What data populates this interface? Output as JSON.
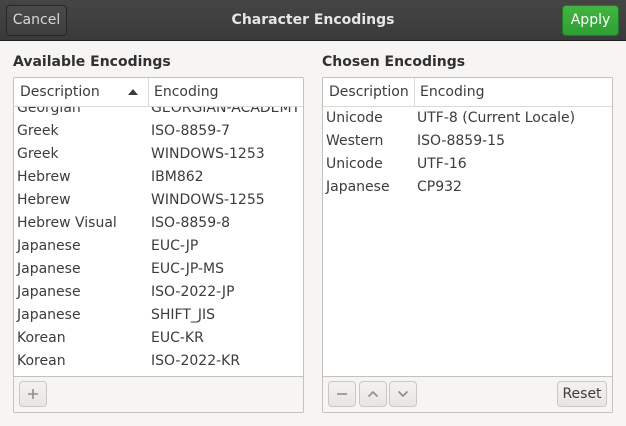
{
  "header": {
    "cancel_label": "Cancel",
    "title": "Character Encodings",
    "apply_label": "Apply",
    "apply_color": "#3daf3d"
  },
  "available": {
    "title": "Available Encodings",
    "columns": {
      "description": "Description",
      "encoding": "Encoding"
    },
    "rows": [
      {
        "description": "Georgian",
        "encoding": "GEORGIAN-ACADEMY"
      },
      {
        "description": "Greek",
        "encoding": "ISO-8859-7"
      },
      {
        "description": "Greek",
        "encoding": "WINDOWS-1253"
      },
      {
        "description": "Hebrew",
        "encoding": "IBM862"
      },
      {
        "description": "Hebrew",
        "encoding": "WINDOWS-1255"
      },
      {
        "description": "Hebrew Visual",
        "encoding": "ISO-8859-8"
      },
      {
        "description": "Japanese",
        "encoding": "EUC-JP"
      },
      {
        "description": "Japanese",
        "encoding": "EUC-JP-MS"
      },
      {
        "description": "Japanese",
        "encoding": "ISO-2022-JP"
      },
      {
        "description": "Japanese",
        "encoding": "SHIFT_JIS"
      },
      {
        "description": "Korean",
        "encoding": "EUC-KR"
      },
      {
        "description": "Korean",
        "encoding": "ISO-2022-KR"
      }
    ],
    "add_icon": "plus-icon"
  },
  "chosen": {
    "title": "Chosen Encodings",
    "columns": {
      "description": "Description",
      "encoding": "Encoding"
    },
    "rows": [
      {
        "description": "Unicode",
        "encoding": "UTF-8 (Current Locale)"
      },
      {
        "description": "Western",
        "encoding": "ISO-8859-15"
      },
      {
        "description": "Unicode",
        "encoding": "UTF-16"
      },
      {
        "description": "Japanese",
        "encoding": "CP932"
      }
    ],
    "remove_icon": "minus-icon",
    "up_icon": "chevron-up-icon",
    "down_icon": "chevron-down-icon",
    "reset_label": "Reset"
  }
}
